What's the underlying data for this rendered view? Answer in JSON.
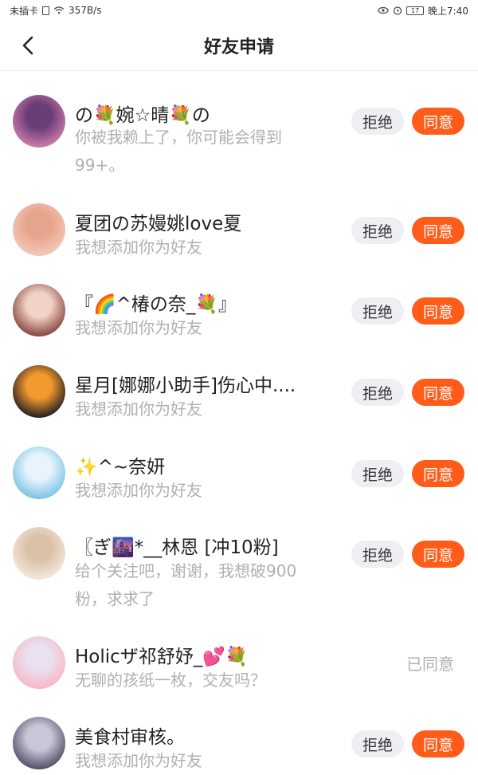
{
  "status_bar": {
    "carrier": "未插卡",
    "speed": "357B/s",
    "battery": "17",
    "time": "晚上7:40"
  },
  "header": {
    "title": "好友申请",
    "back_icon": "back-arrow-icon"
  },
  "buttons": {
    "reject_label": "拒绝",
    "accept_label": "同意",
    "accepted_label": "已同意"
  },
  "requests": [
    {
      "name": "の💐婉☆晴💐の",
      "message": "你被我赖上了，你可能会得到\n99+。",
      "state": "pending"
    },
    {
      "name": "夏团の苏嫚姚love夏",
      "message": "我想添加你为好友",
      "state": "pending"
    },
    {
      "name": "『🌈^椿の奈_💐』",
      "message": "我想添加你为好友",
      "state": "pending"
    },
    {
      "name": "星月[娜娜小助手]伤心中....",
      "message": "我想添加你为好友",
      "state": "pending"
    },
    {
      "name": "✨^~奈妍",
      "message": "我想添加你为好友",
      "state": "pending"
    },
    {
      "name": "〖ぎ🌆*__林恩 [冲10粉]",
      "message": "给个关注吧，谢谢，我想破900\n粉，求求了",
      "state": "pending"
    },
    {
      "name": "Holicザ祁舒妤_💕💐",
      "message": "无聊的孩纸一枚，交友吗？",
      "state": "accepted"
    },
    {
      "name": "美食村审核。",
      "message": "我想添加你为好友",
      "state": "pending"
    }
  ],
  "colors": {
    "accent": "#ff5c1a",
    "reject_bg": "#efeff3",
    "muted_text": "#b0b0b0"
  }
}
